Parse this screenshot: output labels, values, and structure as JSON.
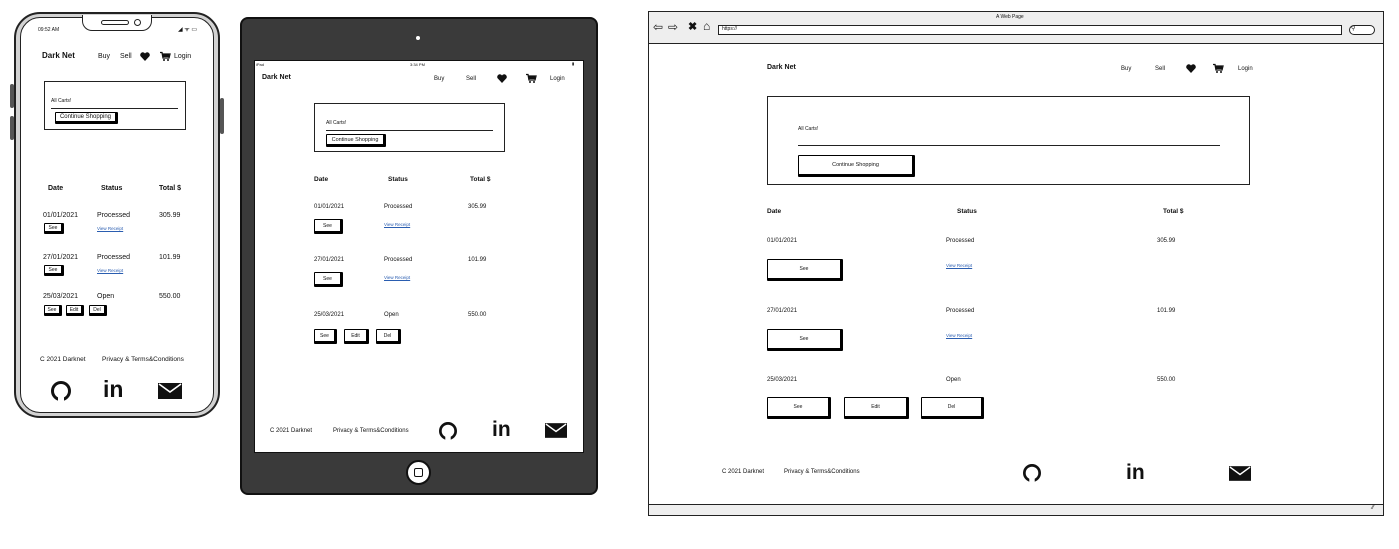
{
  "brand": "Dark Net",
  "nav": {
    "buy": "Buy",
    "sell": "Sell",
    "login": "Login"
  },
  "cart": {
    "title": "All Carts!",
    "continue": "Continue Shopping"
  },
  "table": {
    "headers": {
      "date": "Date",
      "status": "Status",
      "total": "Total $"
    },
    "rows": [
      {
        "date": "01/01/2021",
        "status": "Processed",
        "total": "305.99",
        "see": "See",
        "receipt": "View Receipt"
      },
      {
        "date": "27/01/2021",
        "status": "Processed",
        "total": "101.99",
        "see": "See",
        "receipt": "View Receipt"
      },
      {
        "date": "25/03/2021",
        "status": "Open",
        "total": "550.00",
        "see": "See",
        "edit": "Edit",
        "del": "Del"
      }
    ]
  },
  "footer": {
    "copyright": "C 2021 Darknet",
    "privacy": "Privacy & Terms&Conditions"
  },
  "phone": {
    "time": "09:52 AM"
  },
  "tablet": {
    "carrier": "iPad",
    "time": "3:34 PM"
  },
  "browser": {
    "title": "A Web Page",
    "url": "https://"
  },
  "icons": [
    "github-icon",
    "linkedin-icon",
    "mail-icon",
    "heart-icon",
    "cart-icon"
  ],
  "colors": {
    "frame": "#3a3a3a",
    "phone_body": "#d0d0d0",
    "link": "#2a5db0"
  }
}
